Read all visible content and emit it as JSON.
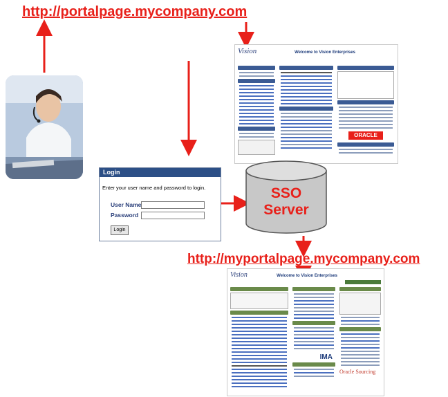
{
  "urls": {
    "top": "http://portalpage.mycompany.com",
    "bottom": "http://myportalpage.mycompany.com"
  },
  "top_portal": {
    "title": "Welcome to Vision Enterprises",
    "brand_logo": "ORACLE"
  },
  "login": {
    "title": "Login",
    "prompt": "Enter your user name and password to login.",
    "username_label": "User Name",
    "username_value": "",
    "password_label": "Password",
    "password_value": "",
    "button_label": "Login"
  },
  "sso": {
    "line1": "SSO",
    "line2": "Server"
  },
  "bottom_portal": {
    "title": "Welcome to Vision Enterprises",
    "logo1": "IMA",
    "logo2": "Oracle Sourcing"
  },
  "colors": {
    "arrow": "#e8201a",
    "url": "#e8201a",
    "login_header": "#2c4f86",
    "cylinder": "#c8c8c8"
  },
  "icons": [
    "user-headset-photo",
    "database-cylinder-icon"
  ]
}
